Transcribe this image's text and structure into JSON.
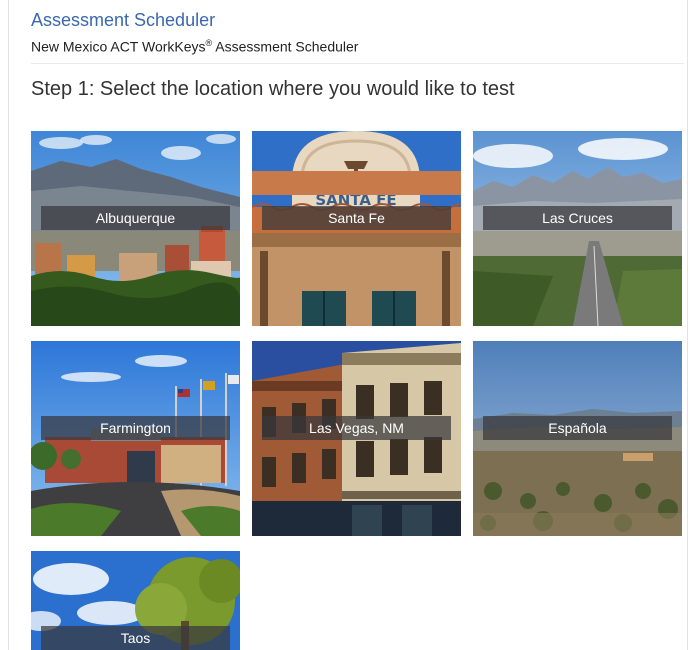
{
  "header": {
    "app_title": "Assessment Scheduler",
    "subtitle_before": "New Mexico ACT WorkKeys",
    "subtitle_sup": "®",
    "subtitle_after": " Assessment Scheduler"
  },
  "step": {
    "title": "Step 1: Select the location where you would like to test"
  },
  "locations": [
    {
      "name": "Albuquerque"
    },
    {
      "name": "Santa Fe"
    },
    {
      "name": "Las Cruces"
    },
    {
      "name": "Farmington"
    },
    {
      "name": "Las Vegas, NM"
    },
    {
      "name": "Española"
    },
    {
      "name": "Taos"
    }
  ],
  "sign_text": "SANTA FE",
  "colors": {
    "title_blue": "#3a68b0",
    "label_bg": "#37373c"
  }
}
